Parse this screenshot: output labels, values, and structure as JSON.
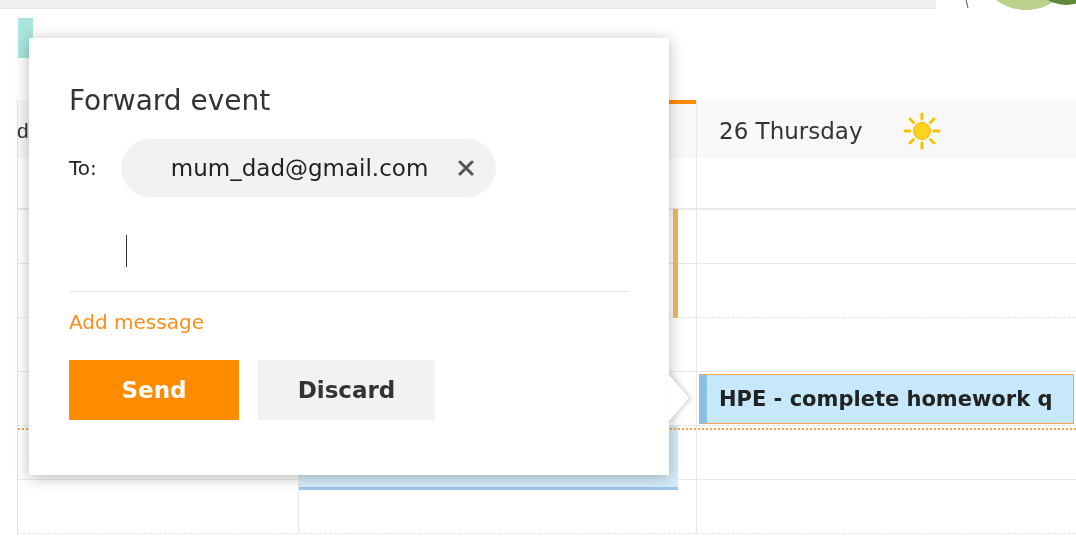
{
  "calendar": {
    "columns": [
      {
        "header": "d",
        "today": false
      },
      {
        "today": true
      },
      {
        "header": "26 Thursday",
        "today": false
      }
    ],
    "event": {
      "title": "HPE - complete homework q",
      "selected": true
    }
  },
  "popup": {
    "title": "Forward event",
    "to_label": "To:",
    "recipients": [
      {
        "email": "mum_dad@gmail.com"
      }
    ],
    "add_message": "Add message",
    "buttons": [
      {
        "label": "Send",
        "kind": "primary"
      },
      {
        "label": "Discard",
        "kind": "secondary"
      }
    ]
  }
}
